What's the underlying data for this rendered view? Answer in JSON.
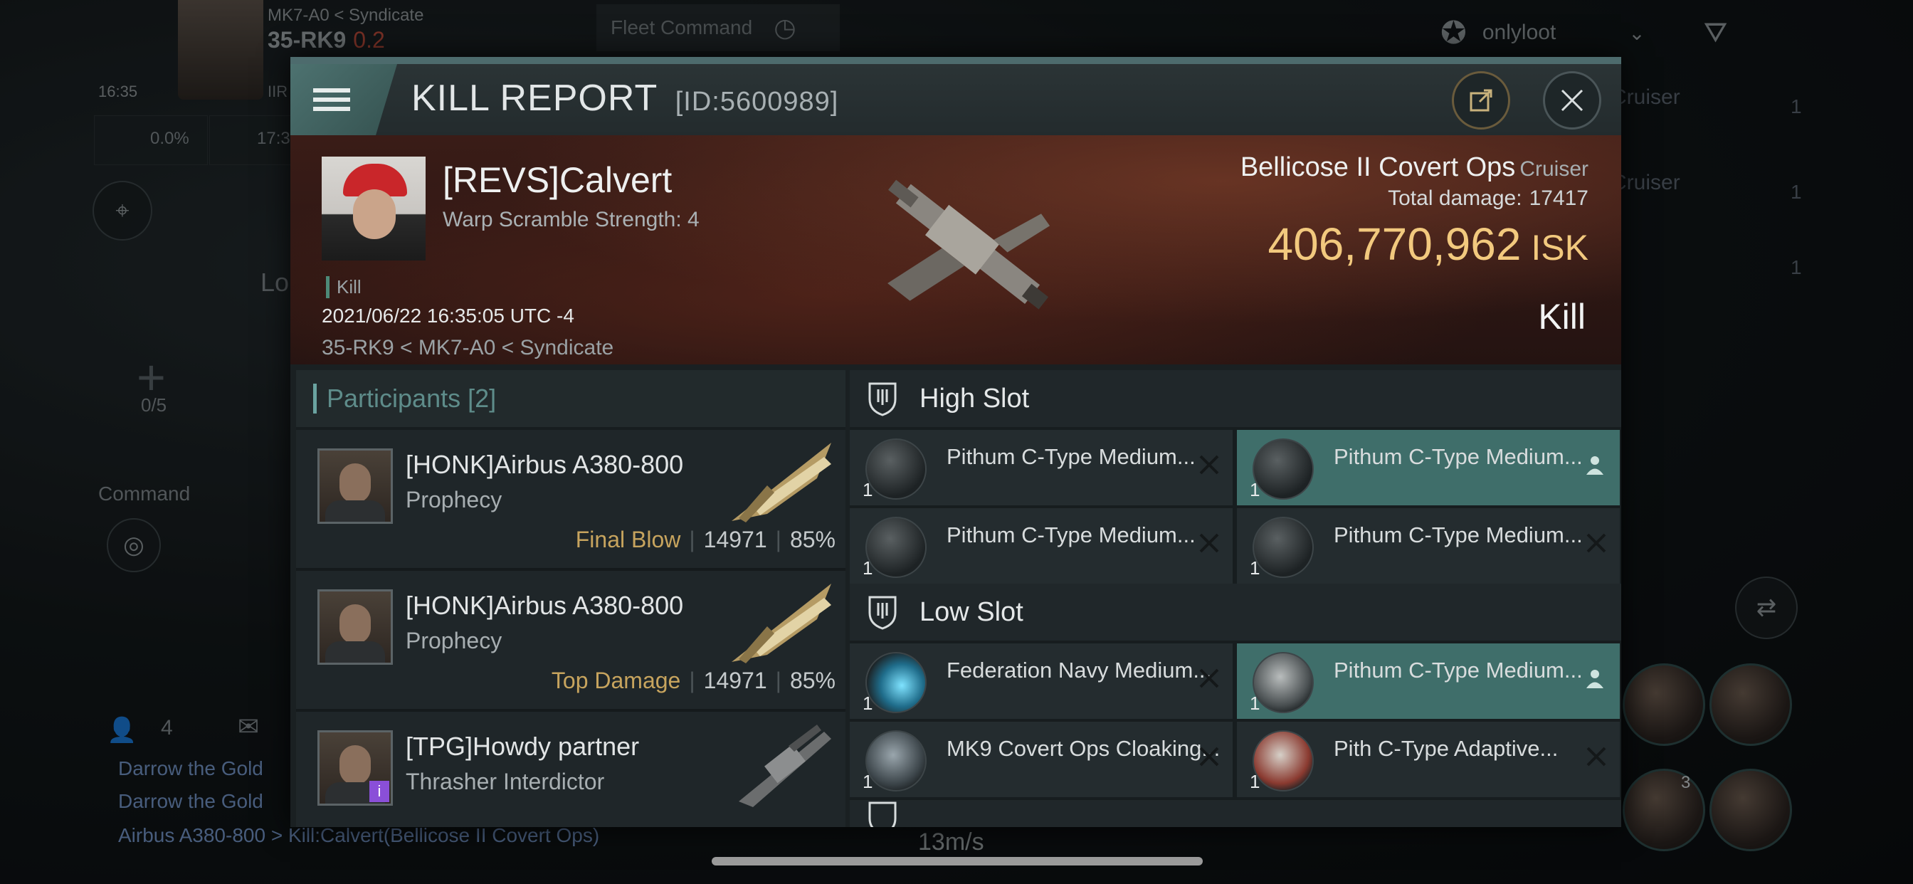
{
  "hud": {
    "system_path": "MK7-A0 < Syndicate",
    "system_name": "35-RK9",
    "security": "0.2",
    "clock": "16:35",
    "corp_tag": "IIR",
    "cargo_pct": "0.0%",
    "other_time": "17:3",
    "local_label": "Lo",
    "fleet_slots": "0/5",
    "command_label": "Command",
    "fleet_command": "Fleet Command",
    "loot_filter": "onlyloot",
    "local_count": "4",
    "right_list": [
      {
        "label": "Cruiser",
        "count": "1"
      },
      {
        "label": "Cruiser",
        "count": "1"
      },
      {
        "label": "",
        "count": "1"
      }
    ],
    "ability_count": "3",
    "speed": "13m/s",
    "feed": [
      "Darrow the Gold",
      "Darrow the Gold",
      "Airbus A380-800 > Kill:Calvert(Bellicose II Covert Ops)"
    ]
  },
  "report": {
    "title": "KILL REPORT",
    "id": "[ID:5600989]",
    "victim": {
      "name": "[REVS]Calvert",
      "warp_scramble": "Warp Scramble Strength: 4",
      "tag": "Kill",
      "time": "2021/06/22 16:35:05 UTC -4",
      "location": "35-RK9 < MK7-A0 < Syndicate"
    },
    "ship": {
      "name": "Bellicose II Covert Ops",
      "class": "Cruiser",
      "damage_label": "Total damage:",
      "damage": "17417",
      "isk_value": "406,770,962",
      "isk_unit": "ISK",
      "result": "Kill"
    },
    "participants": {
      "label": "Participants",
      "count": "[2]",
      "rows": [
        {
          "name": "[HONK]Airbus A380-800",
          "ship": "Prophecy",
          "tag": "Final Blow",
          "damage": "14971",
          "pct": "85%"
        },
        {
          "name": "[HONK]Airbus A380-800",
          "ship": "Prophecy",
          "tag": "Top Damage",
          "damage": "14971",
          "pct": "85%"
        },
        {
          "name": "[TPG]Howdy partner",
          "ship": "Thrasher Interdictor",
          "tag": "",
          "damage": "",
          "pct": ""
        }
      ]
    },
    "high_slot": {
      "label": "High Slot",
      "modules": [
        {
          "name": "Pithum C-Type Medium...",
          "qty": "1",
          "state": "destroyed"
        },
        {
          "name": "Pithum C-Type Medium...",
          "qty": "1",
          "state": "dropped"
        },
        {
          "name": "Pithum C-Type Medium...",
          "qty": "1",
          "state": "destroyed"
        },
        {
          "name": "Pithum C-Type Medium...",
          "qty": "1",
          "state": "destroyed"
        }
      ]
    },
    "low_slot": {
      "label": "Low Slot",
      "modules": [
        {
          "name": "Federation Navy Medium...",
          "qty": "1",
          "state": "destroyed"
        },
        {
          "name": "Pithum C-Type Medium...",
          "qty": "1",
          "state": "dropped"
        },
        {
          "name": "MK9 Covert Ops Cloaking...",
          "qty": "1",
          "state": "destroyed"
        },
        {
          "name": "Pith C-Type Adaptive...",
          "qty": "1",
          "state": "destroyed"
        }
      ]
    }
  },
  "colors": {
    "accent": "#4d7270",
    "highlight_row": "#3f6e6a",
    "isk": "#f2c97e",
    "tag_gold": "#c7a45e"
  }
}
